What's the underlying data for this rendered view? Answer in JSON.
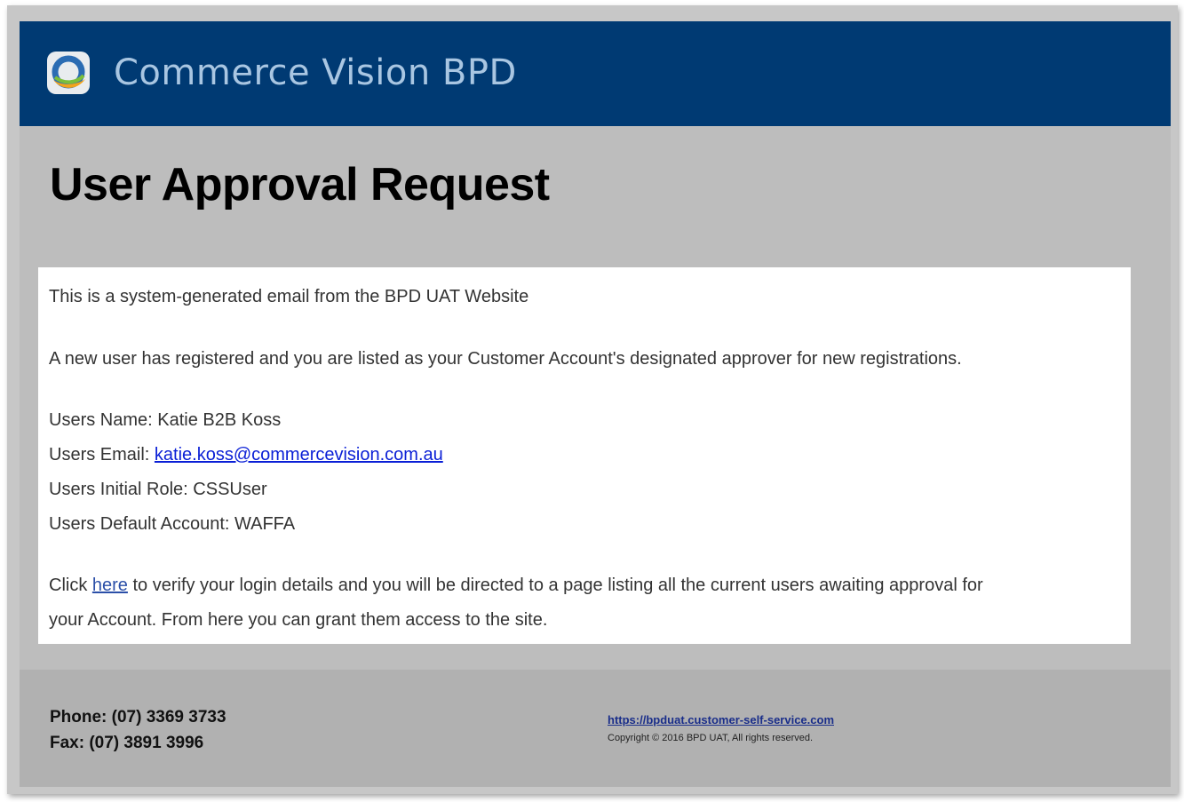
{
  "header": {
    "brand": "Commerce Vision BPD",
    "colors": {
      "banner": "#003a73",
      "brand_text": "#a9c6e2"
    }
  },
  "title": "User Approval Request",
  "body": {
    "intro": "This is a system-generated email from the BPD UAT Website",
    "notice": "A new user has registered and you are listed as your Customer Account's designated approver for new registrations.",
    "name_label": "Users Name: ",
    "name_value": "Katie B2B Koss",
    "email_label": "Users Email: ",
    "email_value": "katie.koss@commercevision.com.au",
    "role_label": "Users Initial Role: ",
    "role_value": "CSSUser",
    "account_label": "Users Default Account: ",
    "account_value": "WAFFA",
    "click_prefix": "Click ",
    "click_link": "here",
    "click_suffix": " to verify your login details and you will be directed to a page listing all the current users awaiting approval for",
    "click_line2": "your Account. From here you can grant them access to the site."
  },
  "footer": {
    "phone": "Phone: (07) 3369 3733",
    "fax": "Fax: (07) 3891 3996",
    "url": "https://bpduat.customer-self-service.com",
    "copyright": "Copyright © 2016 BPD UAT, All rights reserved."
  }
}
